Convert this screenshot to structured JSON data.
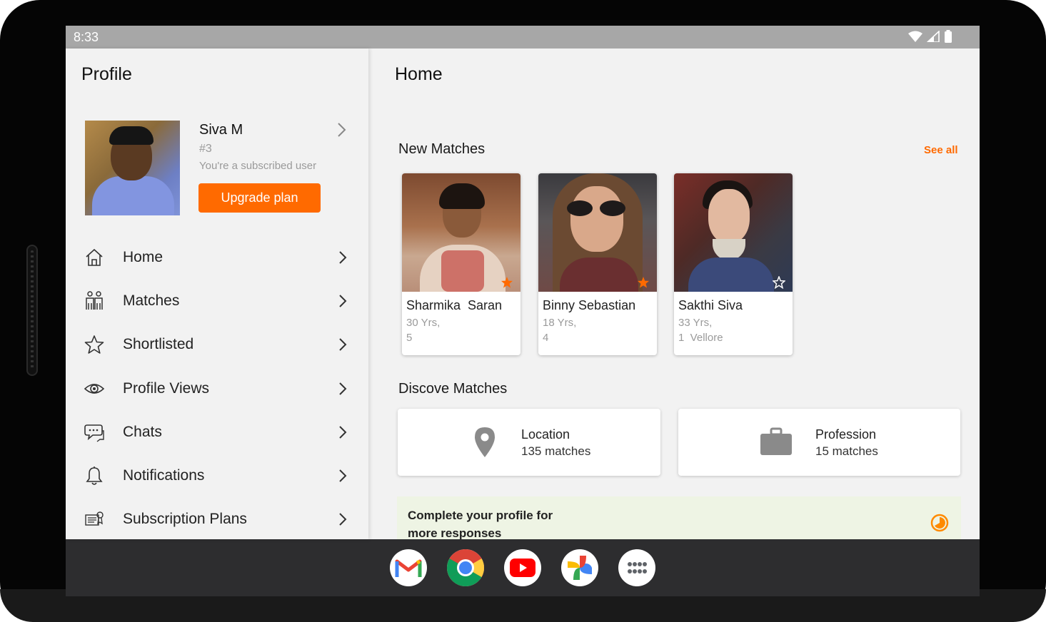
{
  "status_bar": {
    "time": "8:33",
    "icons": [
      "wifi-icon",
      "signal-icon",
      "battery-icon"
    ]
  },
  "profile_panel": {
    "title": "Profile",
    "user": {
      "name": "Siva M",
      "id": "#3",
      "subscription_status": "You're a subscribed user"
    },
    "upgrade_button": "Upgrade plan",
    "menu": [
      {
        "label": "Home",
        "icon": "home-icon"
      },
      {
        "label": "Matches",
        "icon": "couple-icon"
      },
      {
        "label": "Shortlisted",
        "icon": "star-icon"
      },
      {
        "label": "Profile Views",
        "icon": "eye-icon"
      },
      {
        "label": "Chats",
        "icon": "chat-icon"
      },
      {
        "label": "Notifications",
        "icon": "bell-icon"
      },
      {
        "label": "Subscription Plans",
        "icon": "plans-icon"
      }
    ]
  },
  "home": {
    "title": "Home",
    "new_matches": {
      "title": "New Matches",
      "see_all": "See all",
      "cards": [
        {
          "name": "Sharmika  Saran",
          "age": "30 Yrs,",
          "location": "5",
          "shortlisted": true
        },
        {
          "name": "Binny Sebastian",
          "age": "18 Yrs,",
          "location": "4",
          "shortlisted": true
        },
        {
          "name": "Sakthi Siva",
          "age": "33 Yrs,",
          "location": "1  Vellore",
          "shortlisted": false
        }
      ]
    },
    "discover": {
      "title": "Discove Matches",
      "items": [
        {
          "title": "Location",
          "count": "135 matches",
          "icon": "location-pin-icon"
        },
        {
          "title": "Profession",
          "count": "15 matches",
          "icon": "briefcase-icon"
        }
      ]
    },
    "complete_profile": {
      "text": "Complete your profile for more responses",
      "icon": "progress-icon"
    }
  },
  "taskbar": {
    "apps": [
      "Gmail",
      "Chrome",
      "YouTube",
      "Photos",
      "All apps"
    ]
  },
  "colors": {
    "accent": "#ff6a00",
    "background": "#f2f2f2",
    "status_bar": "#a7a7a7",
    "taskbar": "#2d2d2f",
    "complete_banner": "#eef4e4"
  }
}
